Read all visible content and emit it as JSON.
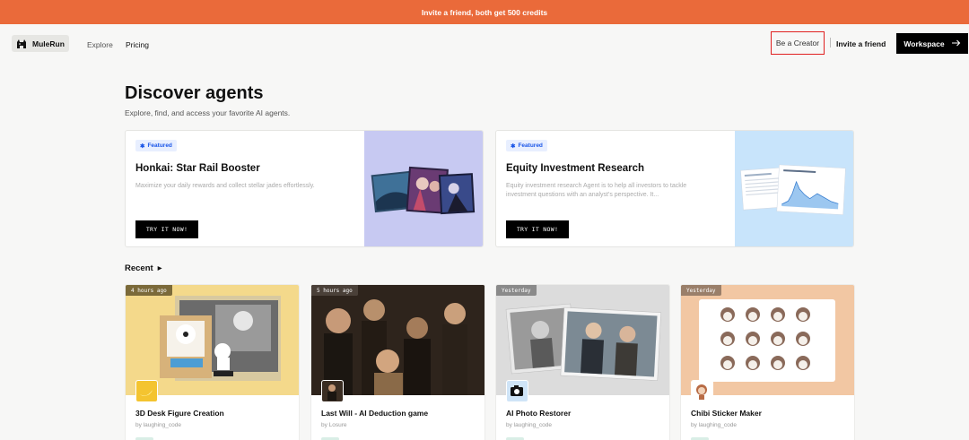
{
  "banner": {
    "text": "Invite a friend, both get 500 credits"
  },
  "nav": {
    "logo_text": "MuleRun",
    "explore": "Explore",
    "pricing": "Pricing",
    "be_creator": "Be a Creator",
    "invite": "Invite a friend",
    "workspace": "Workspace",
    "workspace_icon": "arrow-right-icon"
  },
  "hero": {
    "title": "Discover agents",
    "subtitle": "Explore, find, and access your favorite AI agents."
  },
  "featured": [
    {
      "badge": "Featured",
      "title": "Honkai: Star Rail Booster",
      "description": "Maximize your daily rewards and collect stellar jades effortlessly.",
      "cta": "TRY IT NOW!",
      "accent": "#c7c9f2"
    },
    {
      "badge": "Featured",
      "title": "Equity Investment Research",
      "description": "Equity investment research Agent is to help all investors to tackle investment questions with an analyst's perspective. It...",
      "cta": "TRY IT NOW!",
      "accent": "#c8e4fb"
    }
  ],
  "recent": {
    "heading": "Recent",
    "cards": [
      {
        "time": "4 hours ago",
        "title": "3D Desk Figure Creation",
        "by": "by laughing_code",
        "bg": "#f4d98b",
        "icon": "banana-icon"
      },
      {
        "time": "5 hours ago",
        "title": "Last Will - AI Deduction game",
        "by": "by Losure",
        "bg": "#3a2d22",
        "icon": "portrait-icon"
      },
      {
        "time": "Yesterday",
        "title": "AI Photo Restorer",
        "by": "by laughing_code",
        "bg": "#dcdcdc",
        "icon": "camera-icon"
      },
      {
        "time": "Yesterday",
        "title": "Chibi Sticker Maker",
        "by": "by laughing_code",
        "bg": "#f2c7a3",
        "icon": "chibi-avatar-icon"
      }
    ]
  },
  "colors": {
    "banner": "#ea6a3a",
    "highlight": "#e02020",
    "featured_badge": "#1a56e8"
  }
}
